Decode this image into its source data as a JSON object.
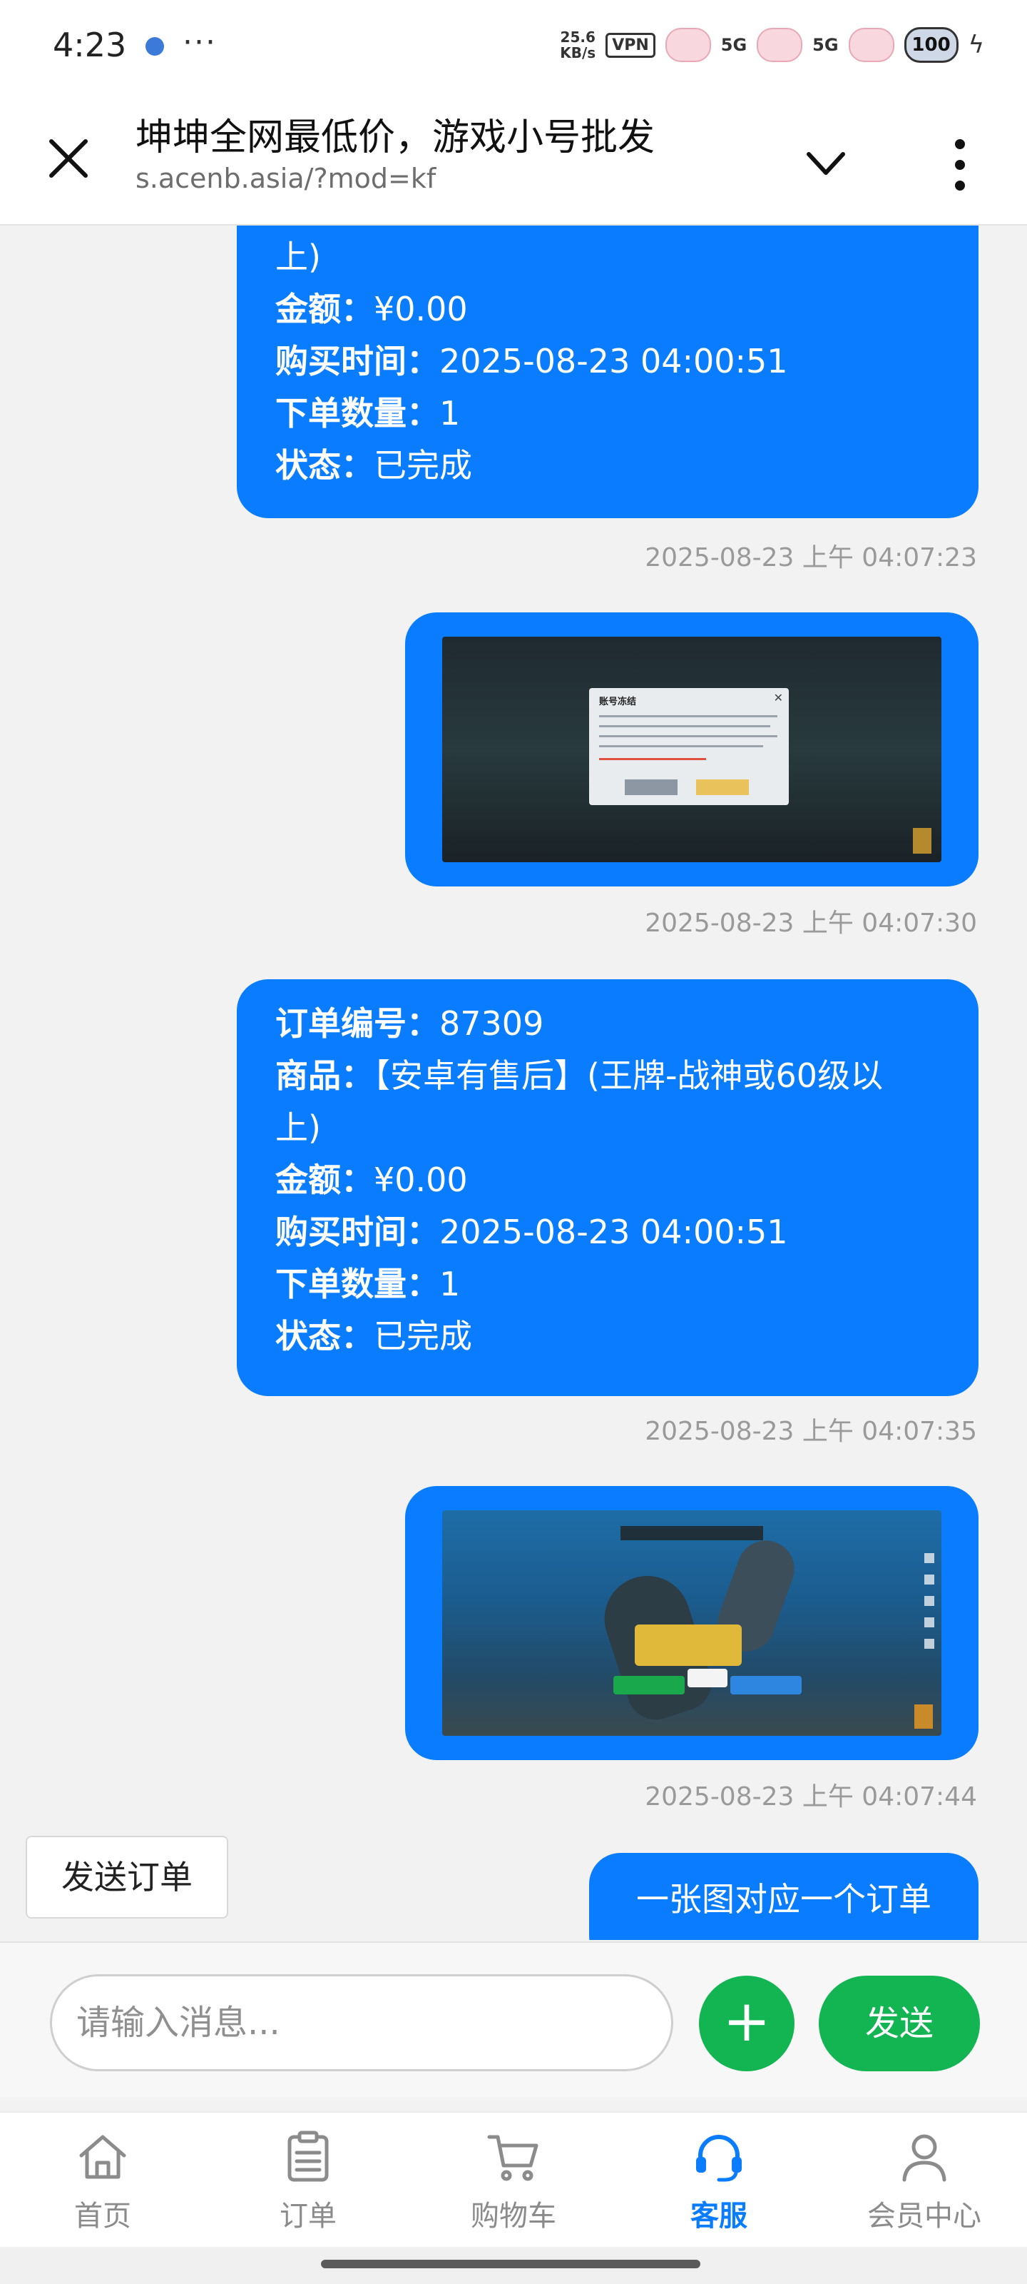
{
  "status_bar": {
    "time": "4:23",
    "dots": "···",
    "speed_value": "25.6",
    "speed_unit": "KB/s",
    "vpn": "VPN",
    "signal1": "5G",
    "signal2": "5G",
    "battery": "100"
  },
  "header": {
    "title": "坤坤全网最低价，游戏小号批发",
    "url": "s.acenb.asia/?mod=kf"
  },
  "messages": [
    {
      "type": "order",
      "lines": [
        {
          "key": "",
          "value": "上)"
        },
        {
          "key": "金额：",
          "value": "¥0.00"
        },
        {
          "key": "购买时间：",
          "value": "2025-08-23 04:00:51"
        },
        {
          "key": "下单数量：",
          "value": "1"
        },
        {
          "key": "状态：",
          "value": "已完成"
        }
      ],
      "timestamp": "2025-08-23 上午 04:07:23"
    },
    {
      "type": "image",
      "dialog_title": "账号冻结",
      "timestamp": "2025-08-23 上午 04:07:30"
    },
    {
      "type": "order",
      "lines": [
        {
          "key": "订单编号：",
          "value": "87309"
        },
        {
          "key": "商品：",
          "value": "【安卓有售后】(王牌-战神或60级以"
        },
        {
          "key": "",
          "value": "上)"
        },
        {
          "key": "金额：",
          "value": "¥0.00"
        },
        {
          "key": "购买时间：",
          "value": "2025-08-23 04:00:51"
        },
        {
          "key": "下单数量：",
          "value": "1"
        },
        {
          "key": "状态：",
          "value": "已完成"
        }
      ],
      "timestamp": "2025-08-23 上午 04:07:35"
    },
    {
      "type": "image",
      "timestamp": "2025-08-23 上午 04:07:44"
    },
    {
      "type": "text",
      "text": "一张图对应一个订单"
    }
  ],
  "send_order_label": "发送订单",
  "input": {
    "placeholder": "请输入消息...",
    "plus_label": "+",
    "send_label": "发送"
  },
  "nav": {
    "items": [
      {
        "label": "首页",
        "icon": "home-icon",
        "active": false
      },
      {
        "label": "订单",
        "icon": "clipboard-icon",
        "active": false
      },
      {
        "label": "购物车",
        "icon": "cart-icon",
        "active": false
      },
      {
        "label": "客服",
        "icon": "headset-icon",
        "active": true
      },
      {
        "label": "会员中心",
        "icon": "user-icon",
        "active": false
      }
    ]
  },
  "colors": {
    "bubble": "#0a7cff",
    "send_button": "#12b552",
    "active_nav": "#0a7cff"
  }
}
